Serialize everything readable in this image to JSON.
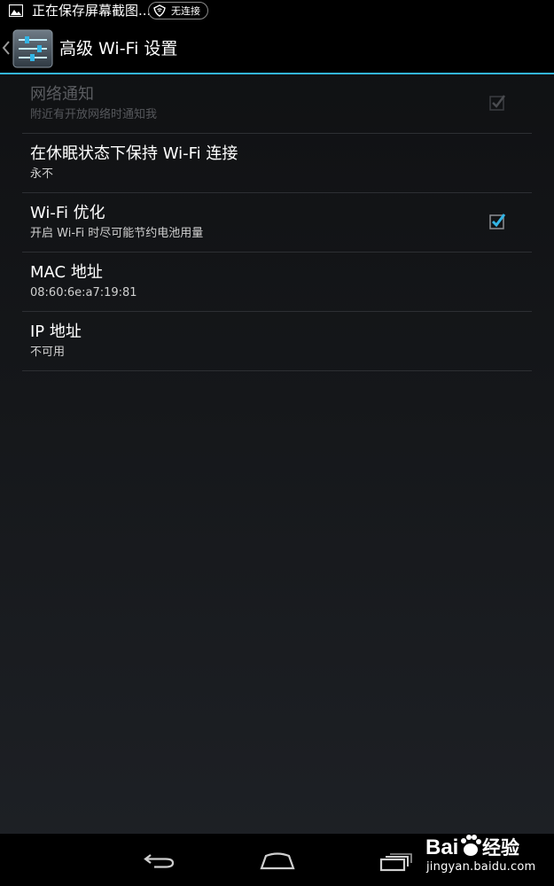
{
  "status_bar": {
    "notification_text": "正在保存屏幕截图...",
    "network_chip_text": "无连接"
  },
  "action_bar": {
    "title": "高级 Wi-Fi 设置",
    "accent_color": "#33b5e5"
  },
  "settings": [
    {
      "title": "网络通知",
      "summary": "附近有开放网络时通知我",
      "enabled": false,
      "checkbox": true,
      "checked": true
    },
    {
      "title": "在休眠状态下保持 Wi-Fi 连接",
      "summary": "永不",
      "enabled": true,
      "checkbox": false
    },
    {
      "title": "Wi-Fi 优化",
      "summary": "开启 Wi-Fi 时尽可能节约电池用量",
      "enabled": true,
      "checkbox": true,
      "checked": true
    },
    {
      "title": "MAC 地址",
      "summary": "08:60:6e:a7:19:81",
      "enabled": true,
      "checkbox": false
    },
    {
      "title": "IP 地址",
      "summary": "不可用",
      "enabled": true,
      "checkbox": false
    }
  ],
  "navigation": {
    "icons": [
      "back-icon",
      "home-icon",
      "recent-apps-icon"
    ]
  },
  "watermark": {
    "logo_text": "Bai 经验",
    "url": "jingyan.baidu.com"
  }
}
